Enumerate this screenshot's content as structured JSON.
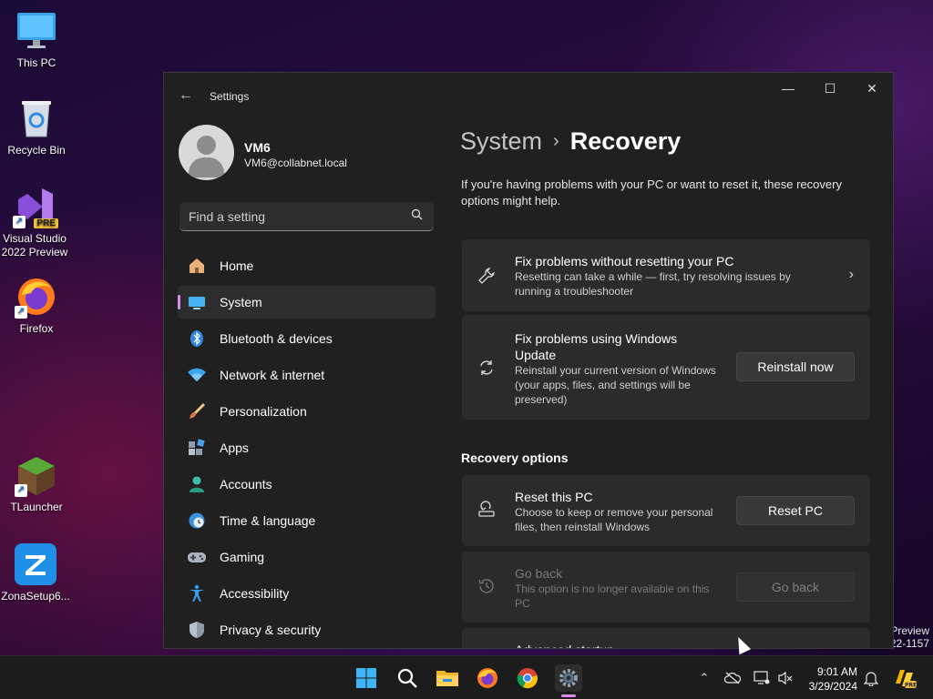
{
  "desktop": {
    "icons": [
      {
        "label": "This PC",
        "icon": "monitor-icon"
      },
      {
        "label": "Recycle Bin",
        "icon": "recycle-bin-icon"
      },
      {
        "label": "Visual Studio 2022 Preview",
        "icon": "visual-studio-icon",
        "badge": "PRE"
      },
      {
        "label": "Firefox",
        "icon": "firefox-icon"
      },
      {
        "label": "TLauncher",
        "icon": "minecraft-block-icon"
      },
      {
        "label": "ZonaSetup6...",
        "icon": "zona-icon"
      }
    ],
    "watermark_line1": "Preview",
    "watermark_line2": "22-1157"
  },
  "window": {
    "title": "Settings",
    "controls": {
      "minimize": "—",
      "maximize": "☐",
      "close": "✕"
    }
  },
  "profile": {
    "name": "VM6",
    "email": "VM6@collabnet.local"
  },
  "search": {
    "placeholder": "Find a setting"
  },
  "nav": {
    "items": [
      {
        "label": "Home",
        "icon": "home-icon"
      },
      {
        "label": "System",
        "icon": "system-icon",
        "active": true
      },
      {
        "label": "Bluetooth & devices",
        "icon": "bluetooth-icon"
      },
      {
        "label": "Network & internet",
        "icon": "wifi-icon"
      },
      {
        "label": "Personalization",
        "icon": "brush-icon"
      },
      {
        "label": "Apps",
        "icon": "apps-icon"
      },
      {
        "label": "Accounts",
        "icon": "accounts-icon"
      },
      {
        "label": "Time & language",
        "icon": "clock-globe-icon"
      },
      {
        "label": "Gaming",
        "icon": "gamepad-icon"
      },
      {
        "label": "Accessibility",
        "icon": "accessibility-icon"
      },
      {
        "label": "Privacy & security",
        "icon": "shield-icon"
      }
    ]
  },
  "main": {
    "breadcrumb_parent": "System",
    "breadcrumb_sep": "›",
    "breadcrumb_current": "Recovery",
    "intro": "If you're having problems with your PC or want to reset it, these recovery options might help.",
    "cards": [
      {
        "title": "Fix problems without resetting your PC",
        "desc": "Resetting can take a while — first, try resolving issues by running a troubleshooter",
        "icon": "wrench-icon"
      },
      {
        "title": "Fix problems using Windows Update",
        "desc": "Reinstall your current version of Windows (your apps, files, and settings will be preserved)",
        "button": "Reinstall now",
        "icon": "sync-icon"
      }
    ],
    "section_title": "Recovery options",
    "options": [
      {
        "title": "Reset this PC",
        "desc": "Choose to keep or remove your personal files, then reinstall Windows",
        "button": "Reset PC",
        "icon": "reset-pc-icon"
      },
      {
        "title": "Go back",
        "desc": "This option is no longer available on this PC",
        "button": "Go back",
        "icon": "history-icon",
        "disabled": true
      },
      {
        "title": "Advanced startup",
        "icon": "advanced-startup-icon"
      }
    ]
  },
  "taskbar": {
    "time": "9:01 AM",
    "date": "3/29/2024",
    "apps": [
      "start-icon",
      "search-icon",
      "file-explorer-icon",
      "firefox-icon",
      "chrome-icon",
      "settings-icon"
    ]
  }
}
